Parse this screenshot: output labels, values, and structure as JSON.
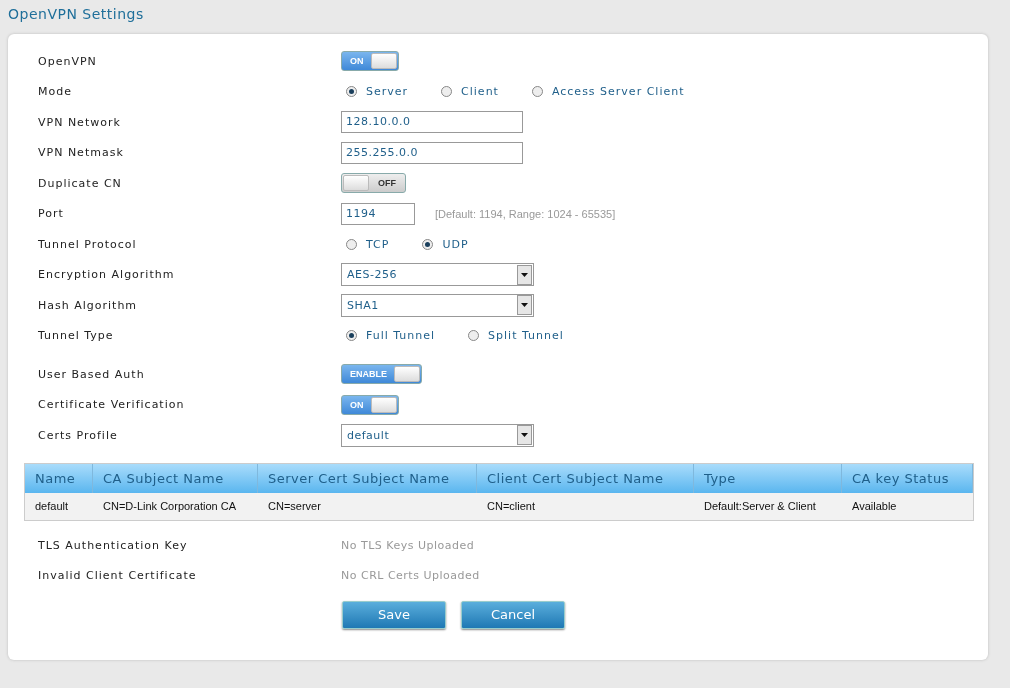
{
  "title": "OpenVPN Settings",
  "fields": [
    {
      "label": "OpenVPN",
      "kind": "toggle",
      "on": true,
      "text": "ON"
    },
    {
      "label": "Mode",
      "kind": "radio",
      "options": [
        {
          "label": "Server",
          "selected": true
        },
        {
          "label": "Client",
          "selected": false
        },
        {
          "label": "Access Server Client",
          "selected": false
        }
      ]
    },
    {
      "label": "VPN Network",
      "kind": "text",
      "value": "128.10.0.0"
    },
    {
      "label": "VPN Netmask",
      "kind": "text",
      "value": "255.255.0.0"
    },
    {
      "label": "Duplicate CN",
      "kind": "toggle",
      "on": false,
      "text": "OFF"
    },
    {
      "label": "Port",
      "kind": "short",
      "value": "1194",
      "hint": "[Default: 1194, Range: 1024 - 65535]"
    },
    {
      "label": "Tunnel Protocol",
      "kind": "radio",
      "options": [
        {
          "label": "TCP",
          "selected": false
        },
        {
          "label": "UDP",
          "selected": true
        }
      ]
    },
    {
      "label": "Encryption Algorithm",
      "kind": "select",
      "value": "AES-256"
    },
    {
      "label": "Hash Algorithm",
      "kind": "select",
      "value": "SHA1"
    },
    {
      "label": "Tunnel Type",
      "kind": "radio",
      "options": [
        {
          "label": "Full Tunnel",
          "selected": true
        },
        {
          "label": "Split Tunnel",
          "selected": false
        }
      ]
    },
    {
      "label": "User Based Auth",
      "kind": "toggle",
      "on": true,
      "text": "ENABLE"
    },
    {
      "label": "Certificate Verification",
      "kind": "toggle",
      "on": true,
      "text": "ON"
    },
    {
      "label": "Certs Profile",
      "kind": "select",
      "value": "default"
    }
  ],
  "table": {
    "columns": [
      "Name",
      "CA Subject Name",
      "Server Cert Subject Name",
      "Client Cert Subject Name",
      "Type",
      "CA key Status"
    ],
    "rows": [
      [
        "default",
        "CN=D-Link Corporation CA",
        "CN=server",
        "CN=client",
        "Default:Server & Client",
        "Available"
      ]
    ]
  },
  "info": [
    {
      "label": "TLS Authentication Key",
      "value": "No TLS Keys Uploaded"
    },
    {
      "label": "Invalid Client Certificate",
      "value": "No CRL Certs Uploaded"
    }
  ],
  "buttons": [
    "Save",
    "Cancel"
  ]
}
